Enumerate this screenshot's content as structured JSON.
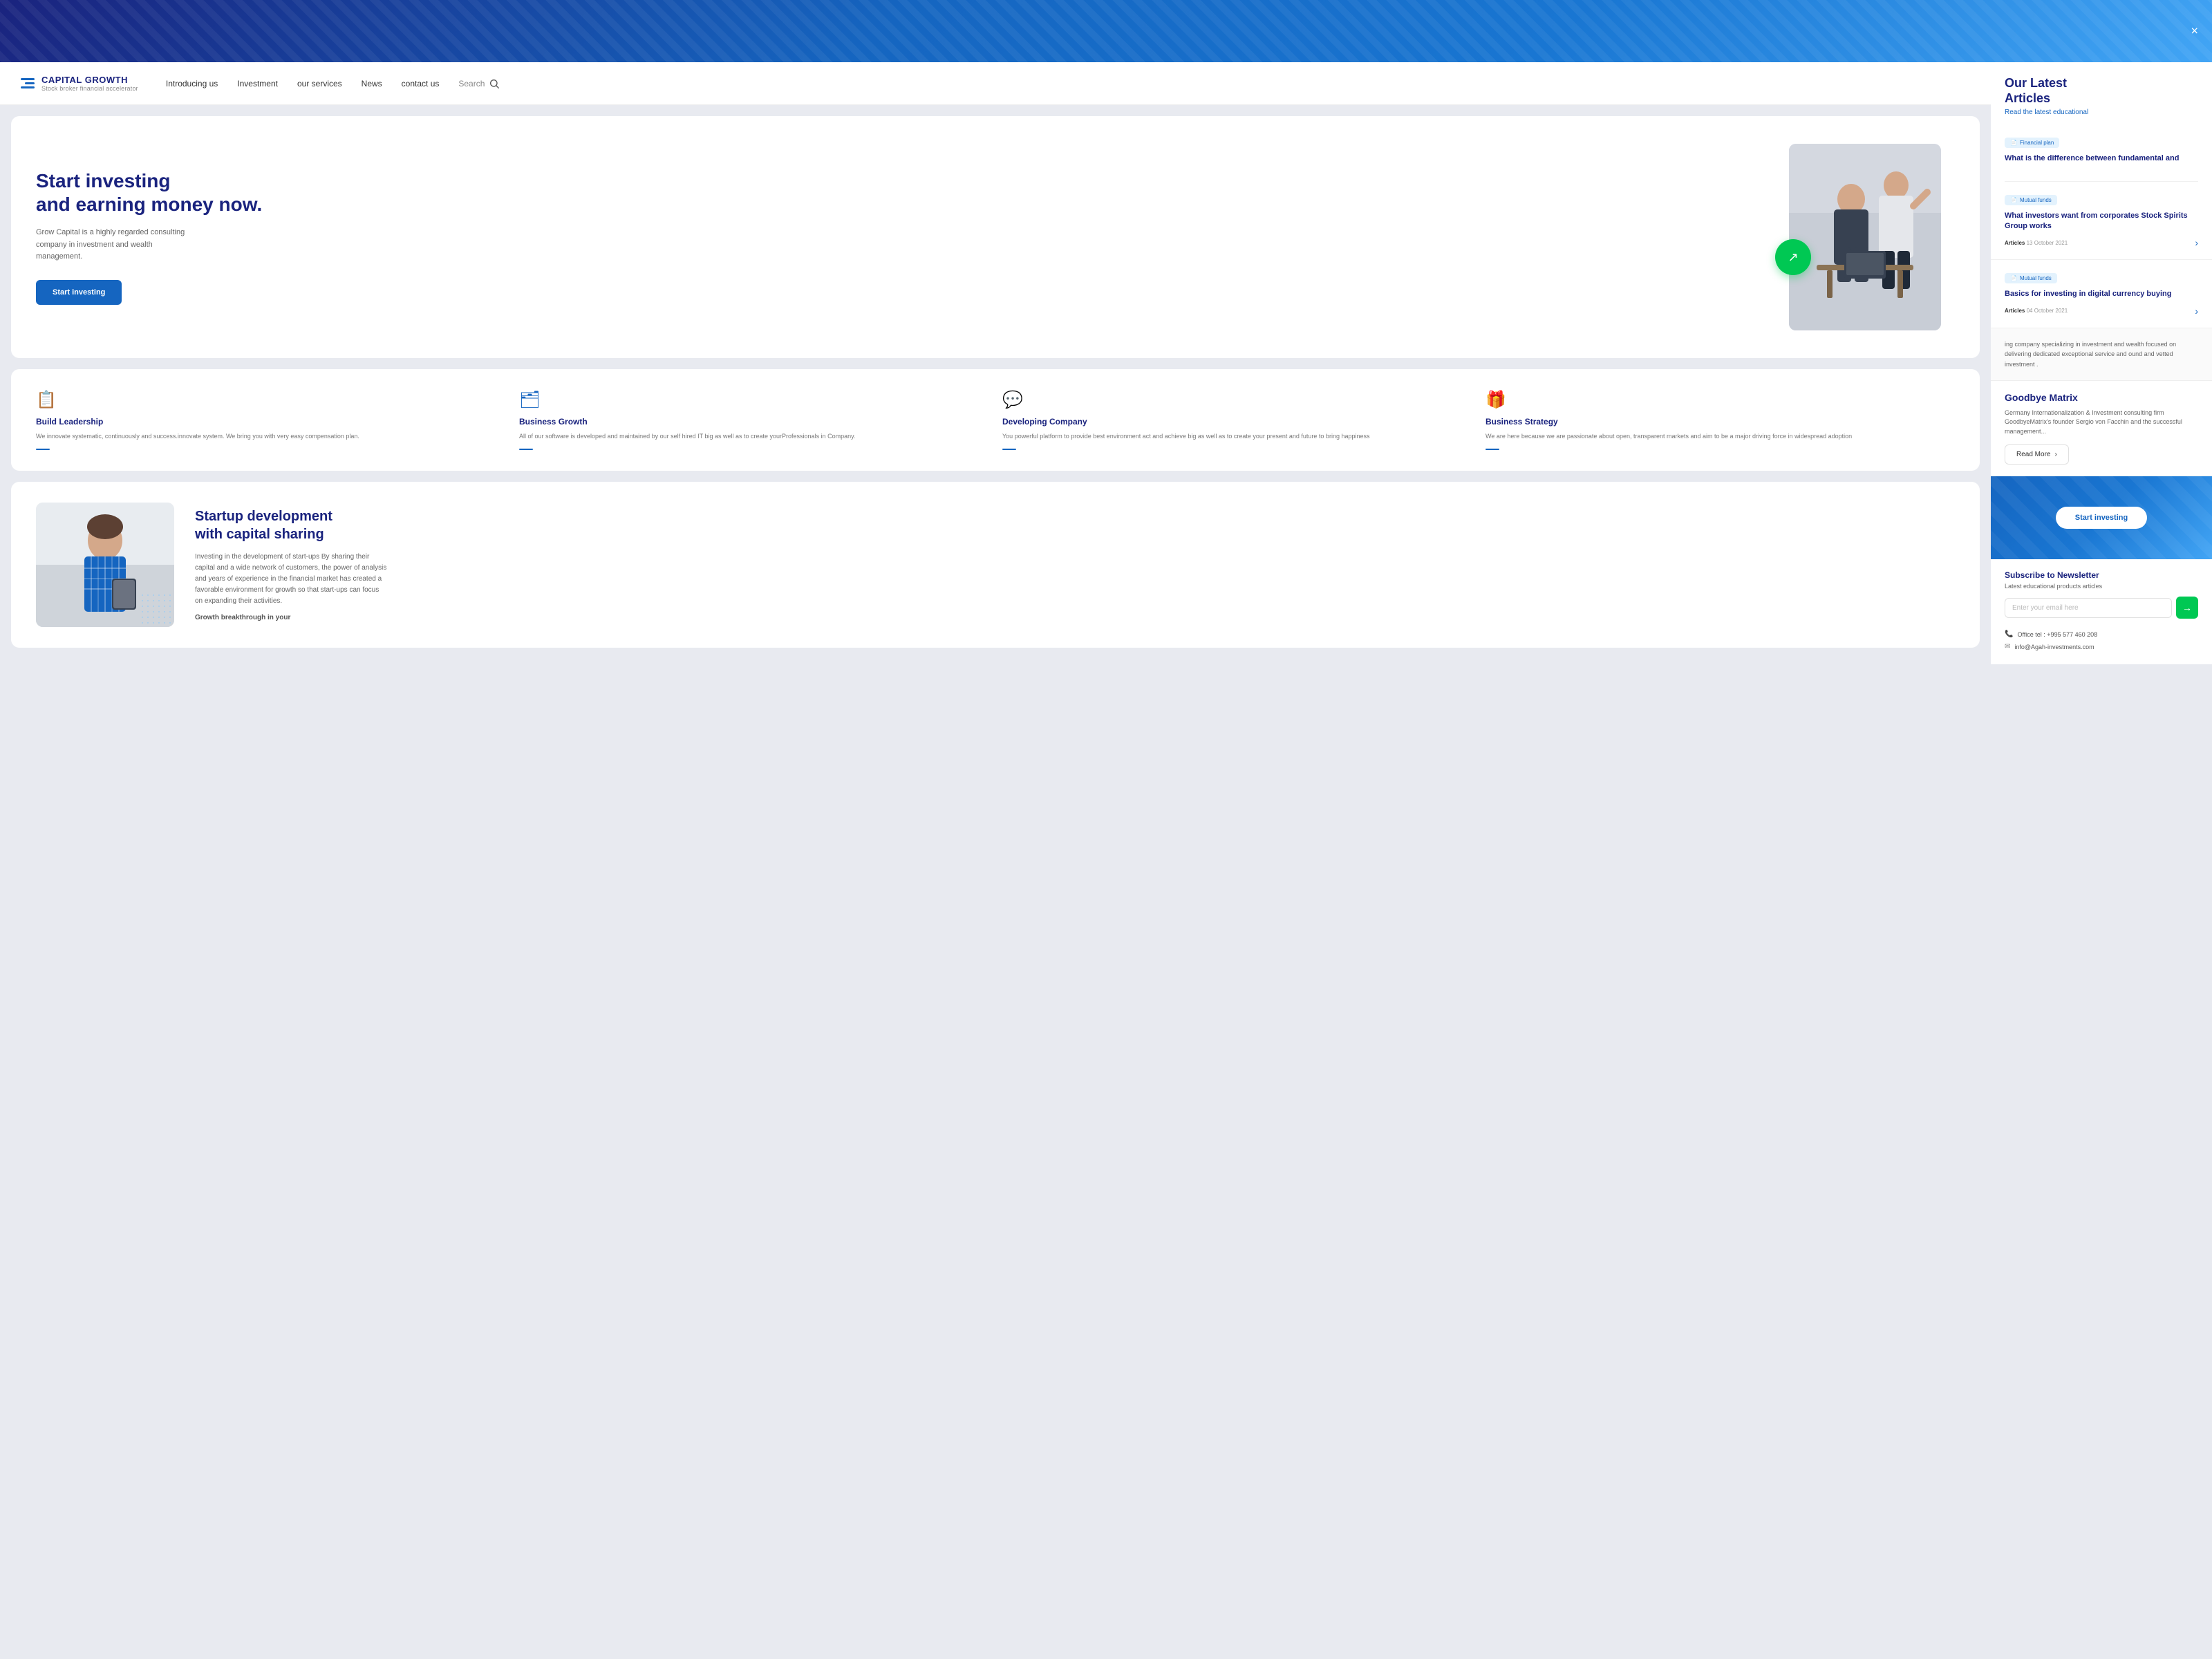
{
  "banner": {
    "close_label": "×"
  },
  "navbar": {
    "logo_name": "CAPITAL GROWTH",
    "logo_sub": "Stock broker financial accelerator",
    "links": [
      {
        "id": "introducing-us",
        "label": "Introducing us"
      },
      {
        "id": "investment",
        "label": "Investment"
      },
      {
        "id": "our-services",
        "label": "our services"
      },
      {
        "id": "news",
        "label": "News"
      },
      {
        "id": "contact-us",
        "label": "contact us"
      }
    ],
    "search_label": "Search"
  },
  "hero": {
    "title_line1": "Start investing",
    "title_line2": "and earning money now.",
    "description": "Grow Capital is a highly regarded consulting company in investment and wealth management.",
    "cta_label": "Start investing"
  },
  "features": [
    {
      "icon": "📋",
      "title": "Build Leadership",
      "desc": "We innovate systematic, continuously and success.innovate system. We bring you with very easy compensation plan."
    },
    {
      "icon": "🗂",
      "title": "Business Growth",
      "desc": "All of our software is developed and maintained by our self hired IT big as well as to create yourProfessionals in Company."
    },
    {
      "icon": "💬",
      "title": "Developing Company",
      "desc": "You powerful platform to provide best environment act and achieve big as well as to create your present and future to bring happiness"
    },
    {
      "icon": "🎁",
      "title": "Business Strategy",
      "desc": "We are here because we are passionate about open, transparent markets and aim to be a major driving force in widespread adoption"
    }
  ],
  "startup": {
    "title_line1": "Startup development",
    "title_line2": "with capital sharing",
    "description": "Investing in the development of start-ups By sharing their capital and a wide network of customers, the power of analysis and years of experience in the financial market has created a favorable environment for growth so that start-ups can focus on expanding their activities.",
    "caption": "Growth breakthrough in your"
  },
  "articles": {
    "heading_line1": "Our Latest",
    "heading_line2": "Articles",
    "subtitle": "Read the latest educational",
    "first_article": {
      "tag": "Financial plan",
      "title": "What is the difference between fundamental and"
    },
    "cards": [
      {
        "tag": "Mutual funds",
        "title": "What investors want from corporates Stock Spirits Group works",
        "meta_label": "Articles",
        "date": "13 October 2021"
      },
      {
        "tag": "Mutual funds",
        "title": "Basics for investing in digital currency buying",
        "meta_label": "Articles",
        "date": "04 October 2021"
      }
    ]
  },
  "company_desc": "ing company specializing in investment and wealth focused on delivering dedicated exceptional service and ound and vetted investment .",
  "goodbye": {
    "title": "Goodbye Matrix",
    "description": "Germany Internationalization & Investment consulting firm GoodbyeMatrix's founder Sergio von Facchin and the successful management...",
    "read_more": "Read More"
  },
  "cta": {
    "label": "Start investing"
  },
  "newsletter": {
    "title": "Subscribe to Newsletter",
    "subtitle": "Latest educational products articles",
    "input_placeholder": "Enter your email here",
    "office_tel": "Office tel : +995 577 460 208",
    "email": "info@Agah-investments.com"
  }
}
